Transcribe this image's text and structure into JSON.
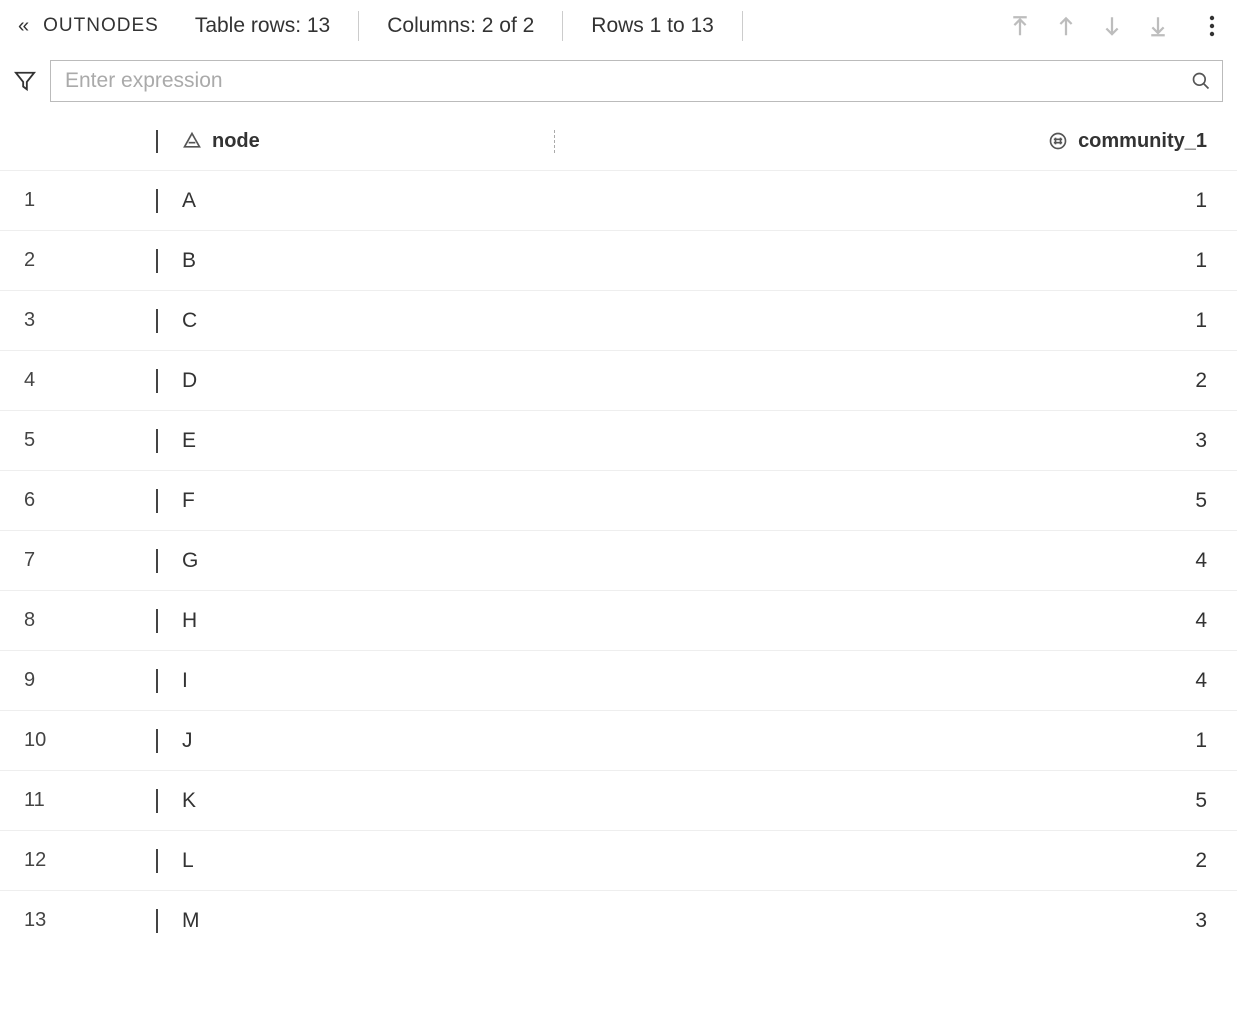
{
  "toolbar": {
    "title": "OUTNODES",
    "table_rows": "Table rows: 13",
    "columns": "Columns: 2 of 2",
    "rows_range": "Rows 1 to 13"
  },
  "filter": {
    "placeholder": "Enter expression"
  },
  "columns": {
    "node": "node",
    "community": "community_1"
  },
  "rows": [
    {
      "n": "1",
      "node": "A",
      "community": "1"
    },
    {
      "n": "2",
      "node": "B",
      "community": "1"
    },
    {
      "n": "3",
      "node": "C",
      "community": "1"
    },
    {
      "n": "4",
      "node": "D",
      "community": "2"
    },
    {
      "n": "5",
      "node": "E",
      "community": "3"
    },
    {
      "n": "6",
      "node": "F",
      "community": "5"
    },
    {
      "n": "7",
      "node": "G",
      "community": "4"
    },
    {
      "n": "8",
      "node": "H",
      "community": "4"
    },
    {
      "n": "9",
      "node": "I",
      "community": "4"
    },
    {
      "n": "10",
      "node": "J",
      "community": "1"
    },
    {
      "n": "11",
      "node": "K",
      "community": "5"
    },
    {
      "n": "12",
      "node": "L",
      "community": "2"
    },
    {
      "n": "13",
      "node": "M",
      "community": "3"
    }
  ]
}
